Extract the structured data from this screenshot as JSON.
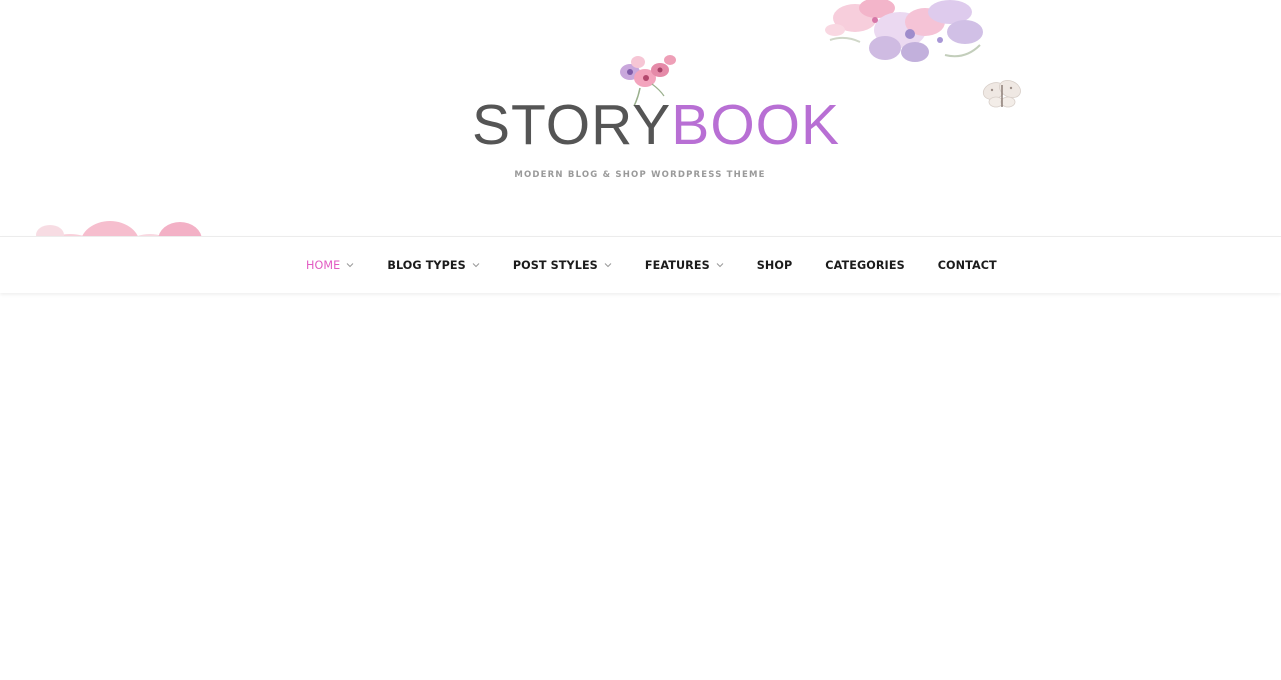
{
  "header": {
    "logo": {
      "word_left": "STORY",
      "word_right": "BOOK",
      "tagline": "MODERN BLOG & SHOP WORDPRESS THEME",
      "icon": "watercolor-flower-icon"
    },
    "decorations": [
      "watercolor-flowers-top-right",
      "butterfly",
      "watercolor-flowers-left"
    ]
  },
  "nav": {
    "items": [
      {
        "label": "HOME",
        "active": true,
        "has_dropdown": true
      },
      {
        "label": "BLOG TYPES",
        "active": false,
        "has_dropdown": true
      },
      {
        "label": "POST STYLES",
        "active": false,
        "has_dropdown": true
      },
      {
        "label": "FEATURES",
        "active": false,
        "has_dropdown": true
      },
      {
        "label": "SHOP",
        "active": false,
        "has_dropdown": false
      },
      {
        "label": "CATEGORIES",
        "active": false,
        "has_dropdown": false
      },
      {
        "label": "CONTACT",
        "active": false,
        "has_dropdown": false
      }
    ]
  },
  "colors": {
    "accent": "#e25bc2",
    "logo_gray": "#555555",
    "logo_purple": "#b86fd4",
    "nav_text": "#1b1b1b"
  }
}
